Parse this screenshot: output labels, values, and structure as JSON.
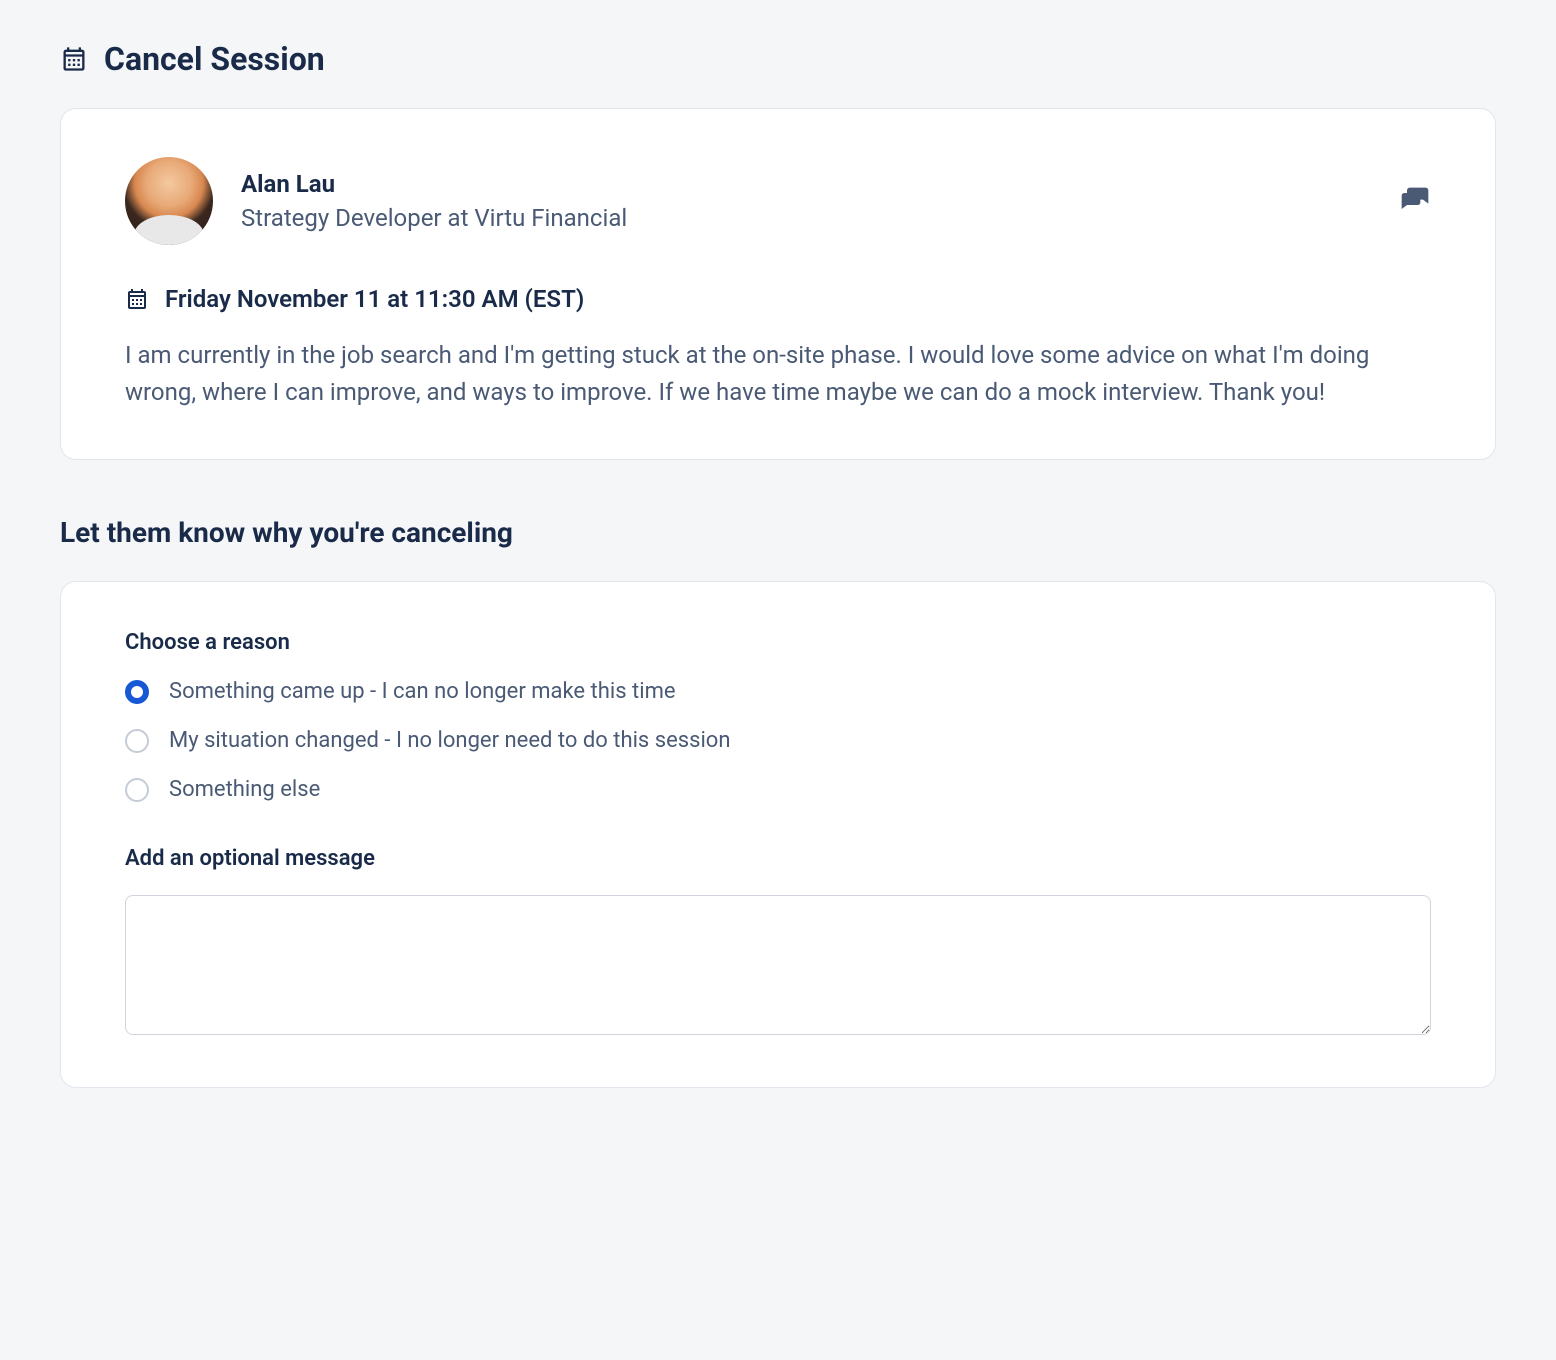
{
  "header": {
    "title": "Cancel Session"
  },
  "session": {
    "user": {
      "name": "Alan Lau",
      "title": "Strategy Developer at Virtu Financial"
    },
    "time": "Friday November 11 at 11:30 AM (EST)",
    "description": "I am currently in the job search and I'm getting stuck at the on-site phase. I would love some advice on what I'm doing wrong, where I can improve, and ways to improve. If we have time maybe we can do a mock interview. Thank you!"
  },
  "cancel_form": {
    "section_heading": "Let them know why you're canceling",
    "reason_label": "Choose a reason",
    "reasons": [
      {
        "label": "Something came up - I can no longer make this time",
        "selected": true
      },
      {
        "label": "My situation changed - I no longer need to do this session",
        "selected": false
      },
      {
        "label": "Something else",
        "selected": false
      }
    ],
    "message_label": "Add an optional message",
    "message_value": ""
  }
}
